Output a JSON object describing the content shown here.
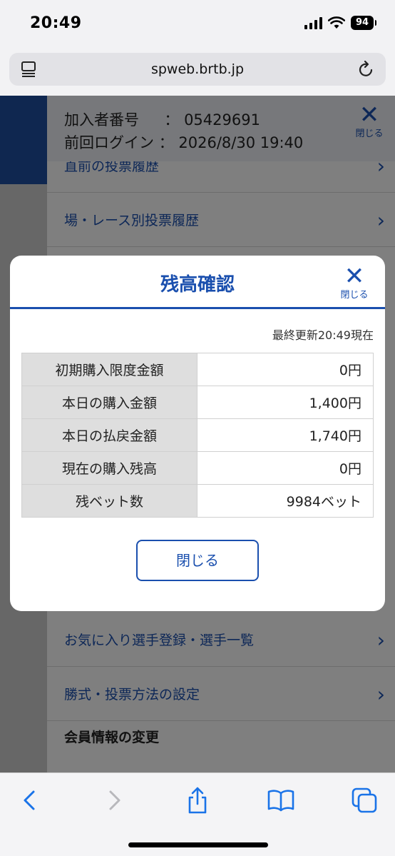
{
  "status_bar": {
    "time": "20:49",
    "battery": "94"
  },
  "browser": {
    "url": "spweb.brtb.jp"
  },
  "drawer": {
    "member_id_label": "加入者番号",
    "member_id_value": "05429691",
    "last_login_label": "前回ログイン",
    "last_login_value": "2026/8/30 19:40",
    "separator": "：",
    "close_label": "閉じる",
    "menu_items": [
      {
        "label": "直前の投票履歴"
      },
      {
        "label": "場・レース別投票履歴"
      },
      {
        "label": "お気に入り選手登録・選手一覧"
      },
      {
        "label": "勝式・投票方法の設定"
      }
    ],
    "section_member": "会員情報の変更"
  },
  "modal": {
    "title": "残高確認",
    "close_label": "閉じる",
    "updated": "最終更新20:49現在",
    "rows": [
      {
        "label": "初期購入限度金額",
        "value": "0円"
      },
      {
        "label": "本日の購入金額",
        "value": "1,400円"
      },
      {
        "label": "本日の払戻金額",
        "value": "1,740円"
      },
      {
        "label": "現在の購入残高",
        "value": "0円"
      },
      {
        "label": "残ベット数",
        "value": "9984ベット"
      }
    ],
    "close_button": "閉じる"
  },
  "colors": {
    "accent": "#1a4fae",
    "toolbar_icon": "#1a73e8"
  }
}
